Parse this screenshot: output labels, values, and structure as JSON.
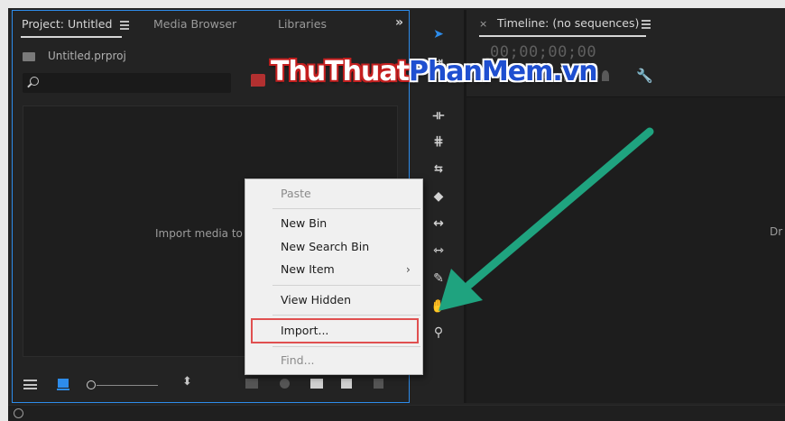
{
  "project_panel": {
    "tabs": [
      {
        "label": "Project: Untitled"
      },
      {
        "label": "Media Browser"
      },
      {
        "label": "Libraries"
      }
    ],
    "overflow_label": "»",
    "file_name": "Untitled.prproj",
    "search_placeholder": "",
    "empty_hint": "Import media to s"
  },
  "timeline": {
    "close_glyph": "×",
    "title": "Timeline: (no sequences)",
    "timecode": "00;00;00;00",
    "hint": "Dr"
  },
  "context_menu": {
    "items": [
      {
        "label": "Paste",
        "enabled": false
      },
      {
        "label": "New Bin",
        "enabled": true
      },
      {
        "label": "New Search Bin",
        "enabled": true
      },
      {
        "label": "New Item",
        "enabled": true,
        "submenu": true
      },
      {
        "label": "View Hidden",
        "enabled": true
      },
      {
        "label": "Import...",
        "enabled": true,
        "highlighted": true
      },
      {
        "label": "Find...",
        "enabled": false
      }
    ],
    "submenu_arrow": "›"
  },
  "watermark": {
    "part1": "ThuThuat",
    "part2": "PhanMem",
    "part3": ".vn"
  },
  "tools": [
    "selection-tool",
    "track-select-tool",
    "ripple-edit-tool",
    "rolling-edit-tool",
    "rate-stretch-tool",
    "razor-tool",
    "slip-tool",
    "slide-tool",
    "pen-tool",
    "hand-tool",
    "zoom-tool"
  ],
  "colors": {
    "accent": "#2d8ceb",
    "highlight_box": "#e05050",
    "arrow": "#1fa37f"
  }
}
